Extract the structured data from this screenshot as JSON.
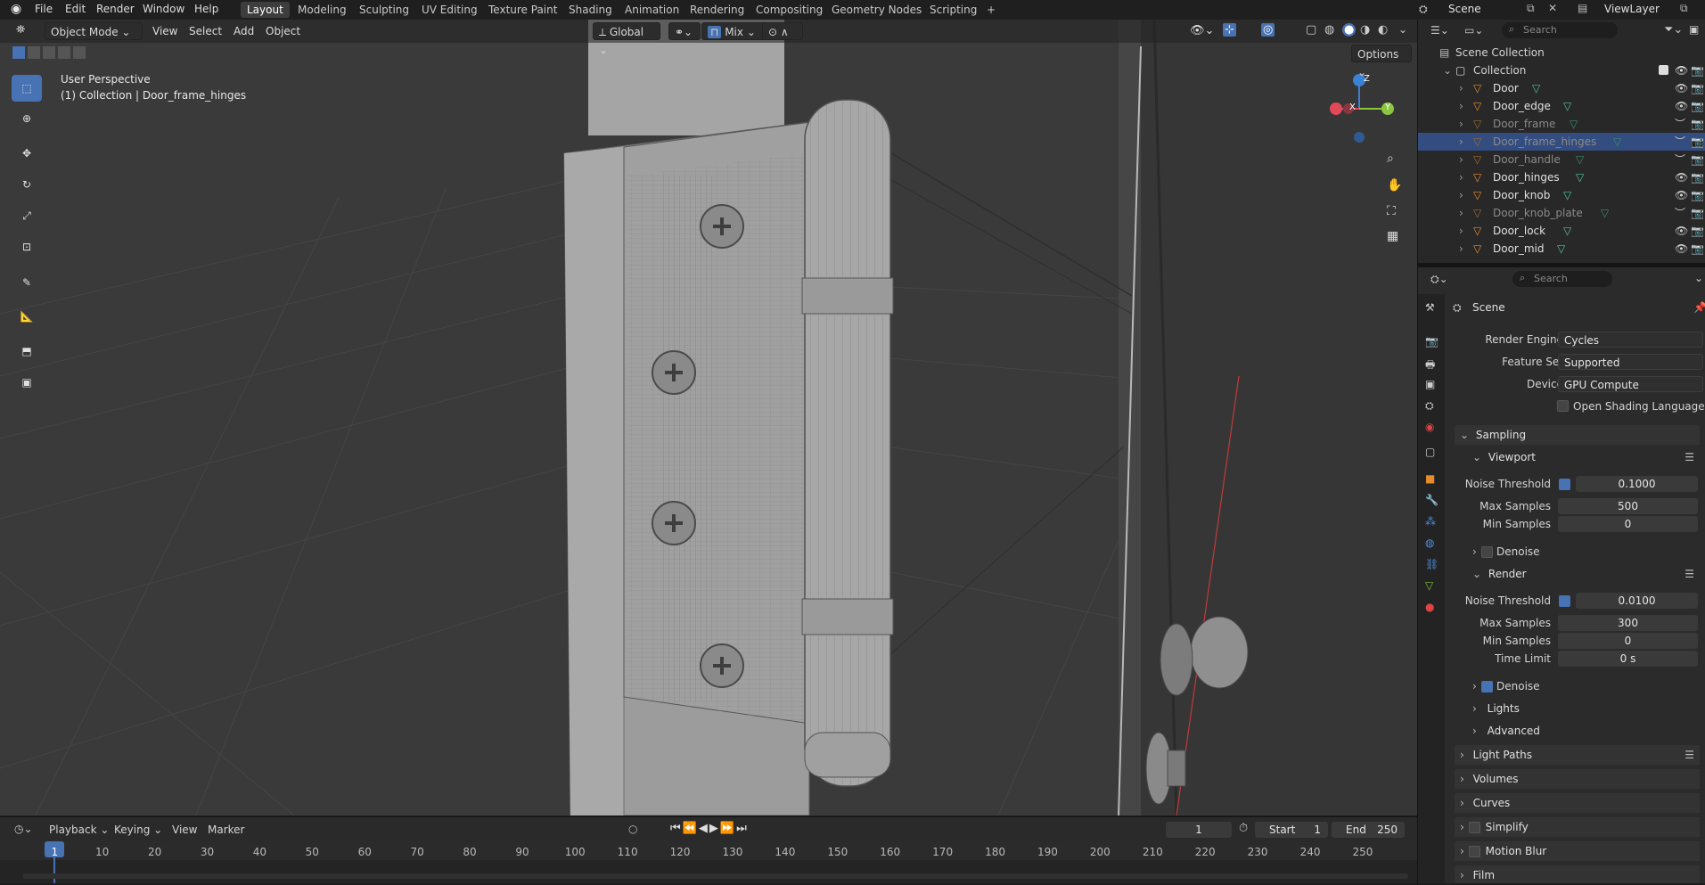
{
  "app": {
    "menu": [
      "File",
      "Edit",
      "Render",
      "Window",
      "Help"
    ],
    "workspaces": [
      "Layout",
      "Modeling",
      "Sculpting",
      "UV Editing",
      "Texture Paint",
      "Shading",
      "Animation",
      "Rendering",
      "Compositing",
      "Geometry Nodes",
      "Scripting"
    ],
    "active_workspace": "Layout",
    "add_workspace": "+",
    "scene_name": "Scene",
    "view_layer": "ViewLayer"
  },
  "viewport_header": {
    "mode": "Object Mode",
    "menus": [
      "View",
      "Select",
      "Add",
      "Object"
    ],
    "transform_orientation": "Global",
    "snap_mode": "Mix",
    "options_label": "Options"
  },
  "viewport": {
    "perspective_label": "User Perspective",
    "object_label": "(1) Collection | Door_frame_hinges",
    "gizmo": {
      "x": "X",
      "y": "Y",
      "z": "Z"
    }
  },
  "outliner": {
    "search_placeholder": "Search",
    "root": "Scene Collection",
    "collection": "Collection",
    "items": [
      {
        "name": "Door",
        "dim": false,
        "selected": false,
        "visible": true
      },
      {
        "name": "Door_edge",
        "dim": false,
        "selected": false,
        "visible": true
      },
      {
        "name": "Door_frame",
        "dim": true,
        "selected": false,
        "visible": false
      },
      {
        "name": "Door_frame_hinges",
        "dim": true,
        "selected": true,
        "visible": false
      },
      {
        "name": "Door_handle",
        "dim": true,
        "selected": false,
        "visible": false
      },
      {
        "name": "Door_hinges",
        "dim": false,
        "selected": false,
        "visible": true
      },
      {
        "name": "Door_knob",
        "dim": false,
        "selected": false,
        "visible": true
      },
      {
        "name": "Door_knob_plate",
        "dim": true,
        "selected": false,
        "visible": false
      },
      {
        "name": "Door_lock",
        "dim": false,
        "selected": false,
        "visible": true
      },
      {
        "name": "Door_mid",
        "dim": false,
        "selected": false,
        "visible": true
      }
    ]
  },
  "properties": {
    "search_placeholder": "Search",
    "context": "Scene",
    "render_engine_label": "Render Engine",
    "render_engine": "Cycles",
    "feature_set_label": "Feature Set",
    "feature_set": "Supported",
    "device_label": "Device",
    "device": "GPU Compute",
    "osl_label": "Open Shading Language",
    "sampling": "Sampling",
    "viewport": {
      "title": "Viewport",
      "noise_threshold_label": "Noise Threshold",
      "noise_threshold": "0.1000",
      "max_samples_label": "Max Samples",
      "max_samples": "500",
      "min_samples_label": "Min Samples",
      "min_samples": "0",
      "denoise_label": "Denoise"
    },
    "render": {
      "title": "Render",
      "noise_threshold_label": "Noise Threshold",
      "noise_threshold": "0.0100",
      "max_samples_label": "Max Samples",
      "max_samples": "300",
      "min_samples_label": "Min Samples",
      "min_samples": "0",
      "time_limit_label": "Time Limit",
      "time_limit": "0 s",
      "denoise_label": "Denoise"
    },
    "subpanels": [
      "Lights",
      "Advanced"
    ],
    "panels": [
      "Light Paths",
      "Volumes",
      "Curves",
      "Simplify",
      "Motion Blur",
      "Film"
    ]
  },
  "timeline": {
    "menus": [
      "Playback",
      "Keying",
      "View",
      "Marker"
    ],
    "current_frame": "1",
    "start_label": "Start",
    "start": "1",
    "end_label": "End",
    "end": "250",
    "ruler": [
      "1",
      "10",
      "20",
      "30",
      "40",
      "50",
      "60",
      "70",
      "80",
      "90",
      "100",
      "110",
      "120",
      "130",
      "140",
      "150",
      "160",
      "170",
      "180",
      "190",
      "200",
      "210",
      "220",
      "230",
      "240",
      "250"
    ]
  },
  "colors": {
    "accent": "#4772b3",
    "selected_row": "#334d80",
    "playhead": "#4772b3",
    "axis_x": "#e04958",
    "axis_y": "#8cc63e",
    "axis_z": "#3b82d6"
  }
}
